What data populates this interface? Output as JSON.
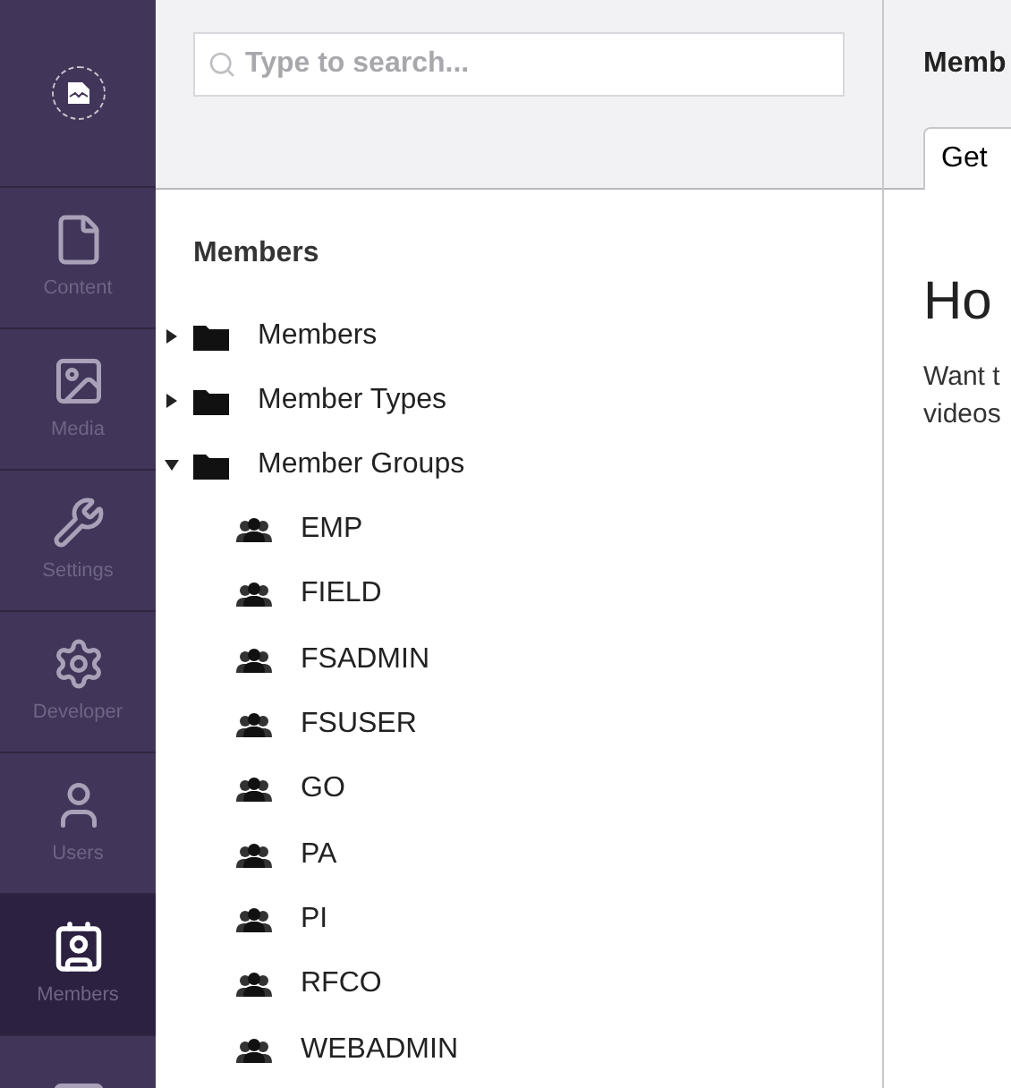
{
  "sections": [
    {
      "kind": "content",
      "label": "Content",
      "selected": false
    },
    {
      "kind": "media",
      "label": "Media",
      "selected": false
    },
    {
      "kind": "settings",
      "label": "Settings",
      "selected": false
    },
    {
      "kind": "developer",
      "label": "Developer",
      "selected": false
    },
    {
      "kind": "users",
      "label": "Users",
      "selected": false
    },
    {
      "kind": "members",
      "label": "Members",
      "selected": true
    },
    {
      "kind": "more",
      "selected": false
    }
  ],
  "search": {
    "placeholder": "Type to search..."
  },
  "tree": {
    "title": "Members",
    "items": [
      {
        "kind": "folder",
        "label": "Members",
        "expanded": false
      },
      {
        "kind": "folder",
        "label": "Member Types",
        "expanded": false
      },
      {
        "kind": "folder",
        "label": "Member Groups",
        "expanded": true,
        "children": [
          {
            "kind": "group",
            "label": "EMP"
          },
          {
            "kind": "group",
            "label": "FIELD"
          },
          {
            "kind": "group",
            "label": "FSADMIN"
          },
          {
            "kind": "group",
            "label": "FSUSER"
          },
          {
            "kind": "group",
            "label": "GO"
          },
          {
            "kind": "group",
            "label": "PA"
          },
          {
            "kind": "group",
            "label": "PI"
          },
          {
            "kind": "group",
            "label": "RFCO"
          },
          {
            "kind": "group",
            "label": "WEBADMIN"
          }
        ]
      }
    ]
  },
  "dashboard": {
    "title": "Memb",
    "tabs": [
      {
        "label": "Get",
        "selected": true
      }
    ],
    "heading": "Ho",
    "text_lines": [
      "Want t",
      "videos"
    ]
  }
}
